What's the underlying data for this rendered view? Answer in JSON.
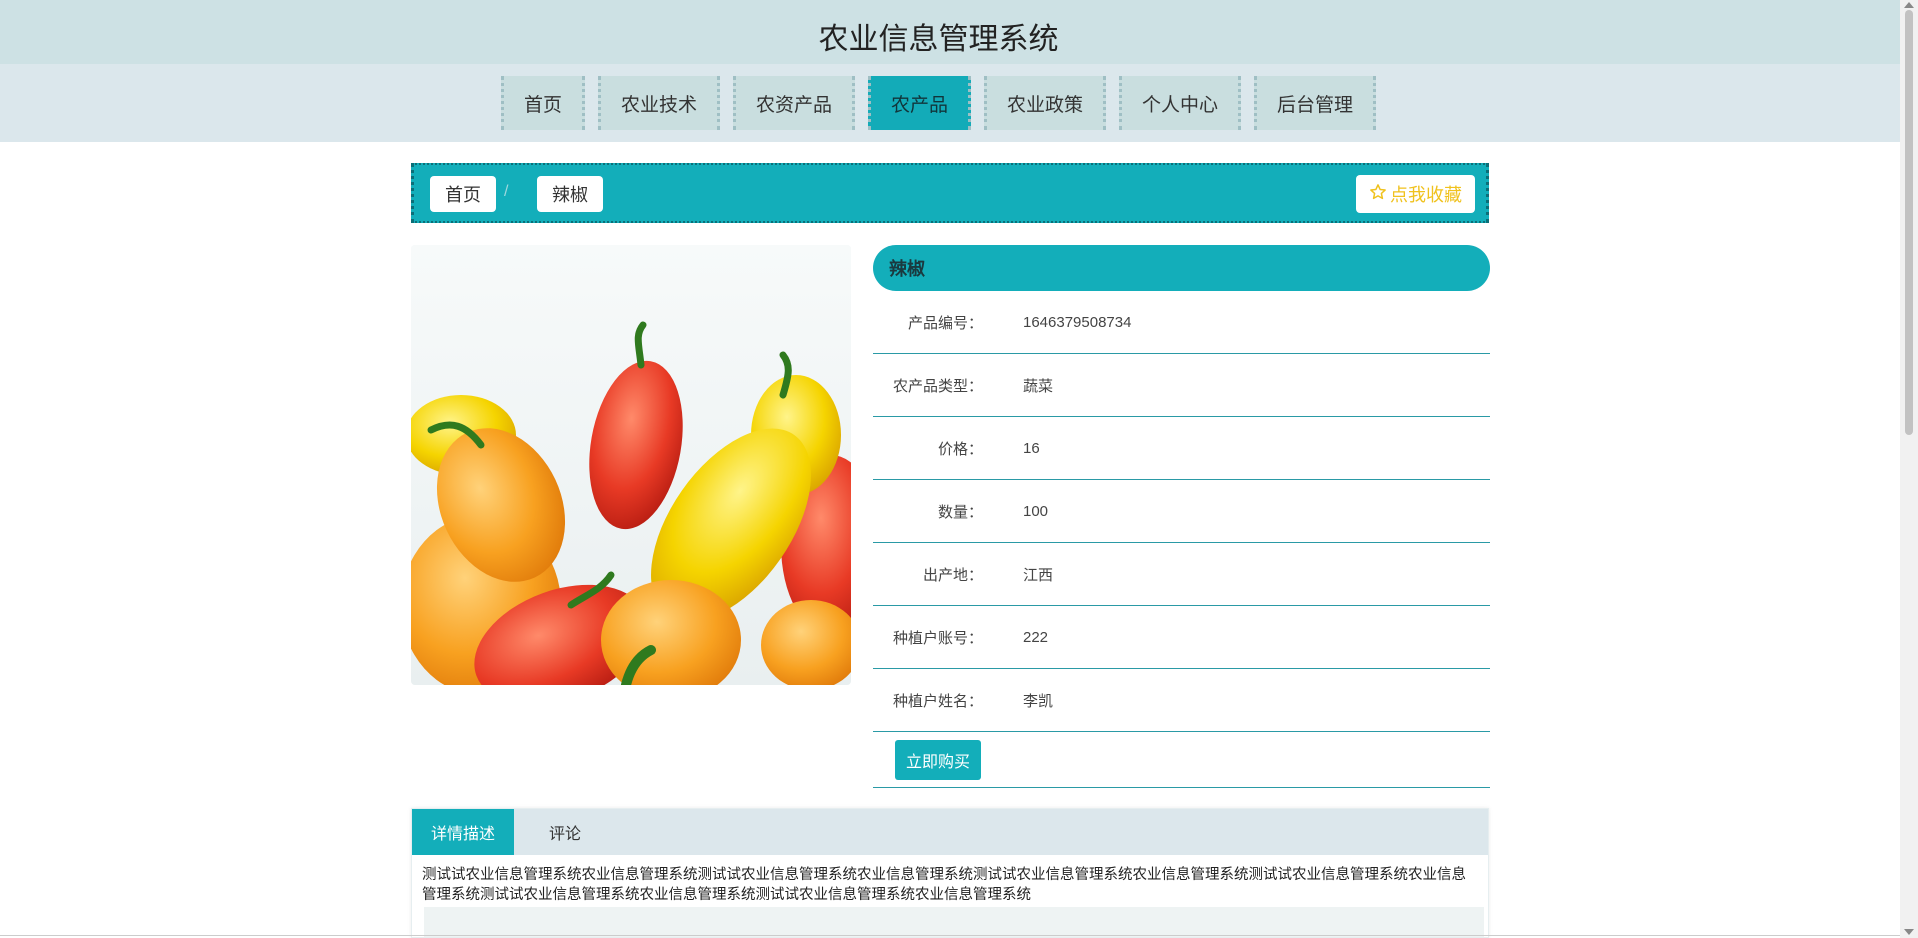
{
  "header": {
    "title": "农业信息管理系统"
  },
  "nav": {
    "items": [
      {
        "label": "首页"
      },
      {
        "label": "农业技术"
      },
      {
        "label": "农资产品"
      },
      {
        "label": "农产品",
        "active": true
      },
      {
        "label": "农业政策"
      },
      {
        "label": "个人中心"
      },
      {
        "label": "后台管理"
      }
    ]
  },
  "breadcrumb": {
    "home": "首页",
    "separator": "/",
    "current": "辣椒"
  },
  "favorite": {
    "label": "点我收藏",
    "icon": "star-outline-icon"
  },
  "product": {
    "name": "辣椒",
    "fields": [
      {
        "label": "产品编号：",
        "value": "1646379508734"
      },
      {
        "label": "农产品类型：",
        "value": "蔬菜"
      },
      {
        "label": "价格：",
        "value": "16"
      },
      {
        "label": "数量：",
        "value": "100"
      },
      {
        "label": "出产地：",
        "value": "江西"
      },
      {
        "label": "种植户账号：",
        "value": "222"
      },
      {
        "label": "种植户姓名：",
        "value": "李凯"
      }
    ],
    "buy_label": "立即购买"
  },
  "tabs": [
    {
      "label": "详情描述",
      "active": true
    },
    {
      "label": "评论"
    }
  ],
  "description": "测试试农业信息管理系统农业信息管理系统测试试农业信息管理系统农业信息管理系统测试试农业信息管理系统农业信息管理系统测试试农业信息管理系统农业信息管理系统测试试农业信息管理系统农业信息管理系统测试试农业信息管理系统农业信息管理系统",
  "colors": {
    "accent": "#13aeba",
    "header_bg": "#cde1e4",
    "nav_bg": "#dbe7ec",
    "favorite": "#f0c21e"
  }
}
